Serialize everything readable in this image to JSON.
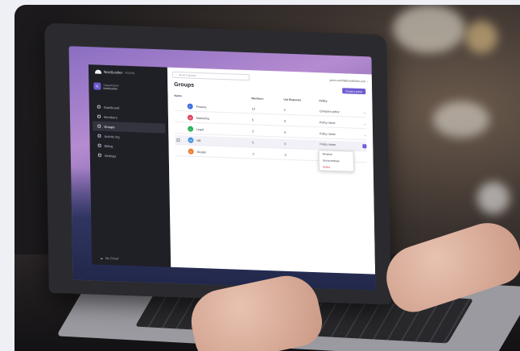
{
  "app": {
    "logo_text": "NordLocker",
    "logo_sub": "Home",
    "org_label": "Organization",
    "org_name": "NordLocker",
    "org_initial": "N"
  },
  "sidebar": {
    "items": [
      {
        "label": "Dashboard",
        "icon": "dashboard-icon"
      },
      {
        "label": "Members",
        "icon": "members-icon"
      },
      {
        "label": "Groups",
        "icon": "groups-icon",
        "active": true
      },
      {
        "label": "Activity log",
        "icon": "activity-icon"
      },
      {
        "label": "Billing",
        "icon": "billing-icon"
      },
      {
        "label": "Settings",
        "icon": "settings-icon"
      }
    ],
    "footer": "My Cloud"
  },
  "topbar": {
    "search_placeholder": "Search groups",
    "user_email": "james.smith@nordlocker.com"
  },
  "page": {
    "title": "Groups",
    "create_button": "Create a group"
  },
  "table": {
    "headers": [
      "Name",
      "Members",
      "Unl Requests",
      "Policy"
    ],
    "rows": [
      {
        "initial": "F",
        "name": "Finance",
        "members": "10",
        "requests": "2",
        "policy": "Compare policy",
        "color": "#3b6fe0"
      },
      {
        "initial": "M",
        "name": "Marketing",
        "members": "5",
        "requests": "0",
        "policy": "Policy name",
        "color": "#e0455b"
      },
      {
        "initial": "L",
        "name": "Legal",
        "members": "3",
        "requests": "0",
        "policy": "Policy name",
        "color": "#2fb35a"
      },
      {
        "initial": "HR",
        "name": "HR",
        "members": "5",
        "requests": "0",
        "policy": "Policy name",
        "color": "#3b8fe0"
      },
      {
        "initial": "D",
        "name": "Design",
        "members": "3",
        "requests": "0",
        "policy": "",
        "color": "#f07a2a"
      }
    ]
  },
  "context_menu": {
    "items": [
      "Rename",
      "Group settings",
      "Delete"
    ]
  }
}
